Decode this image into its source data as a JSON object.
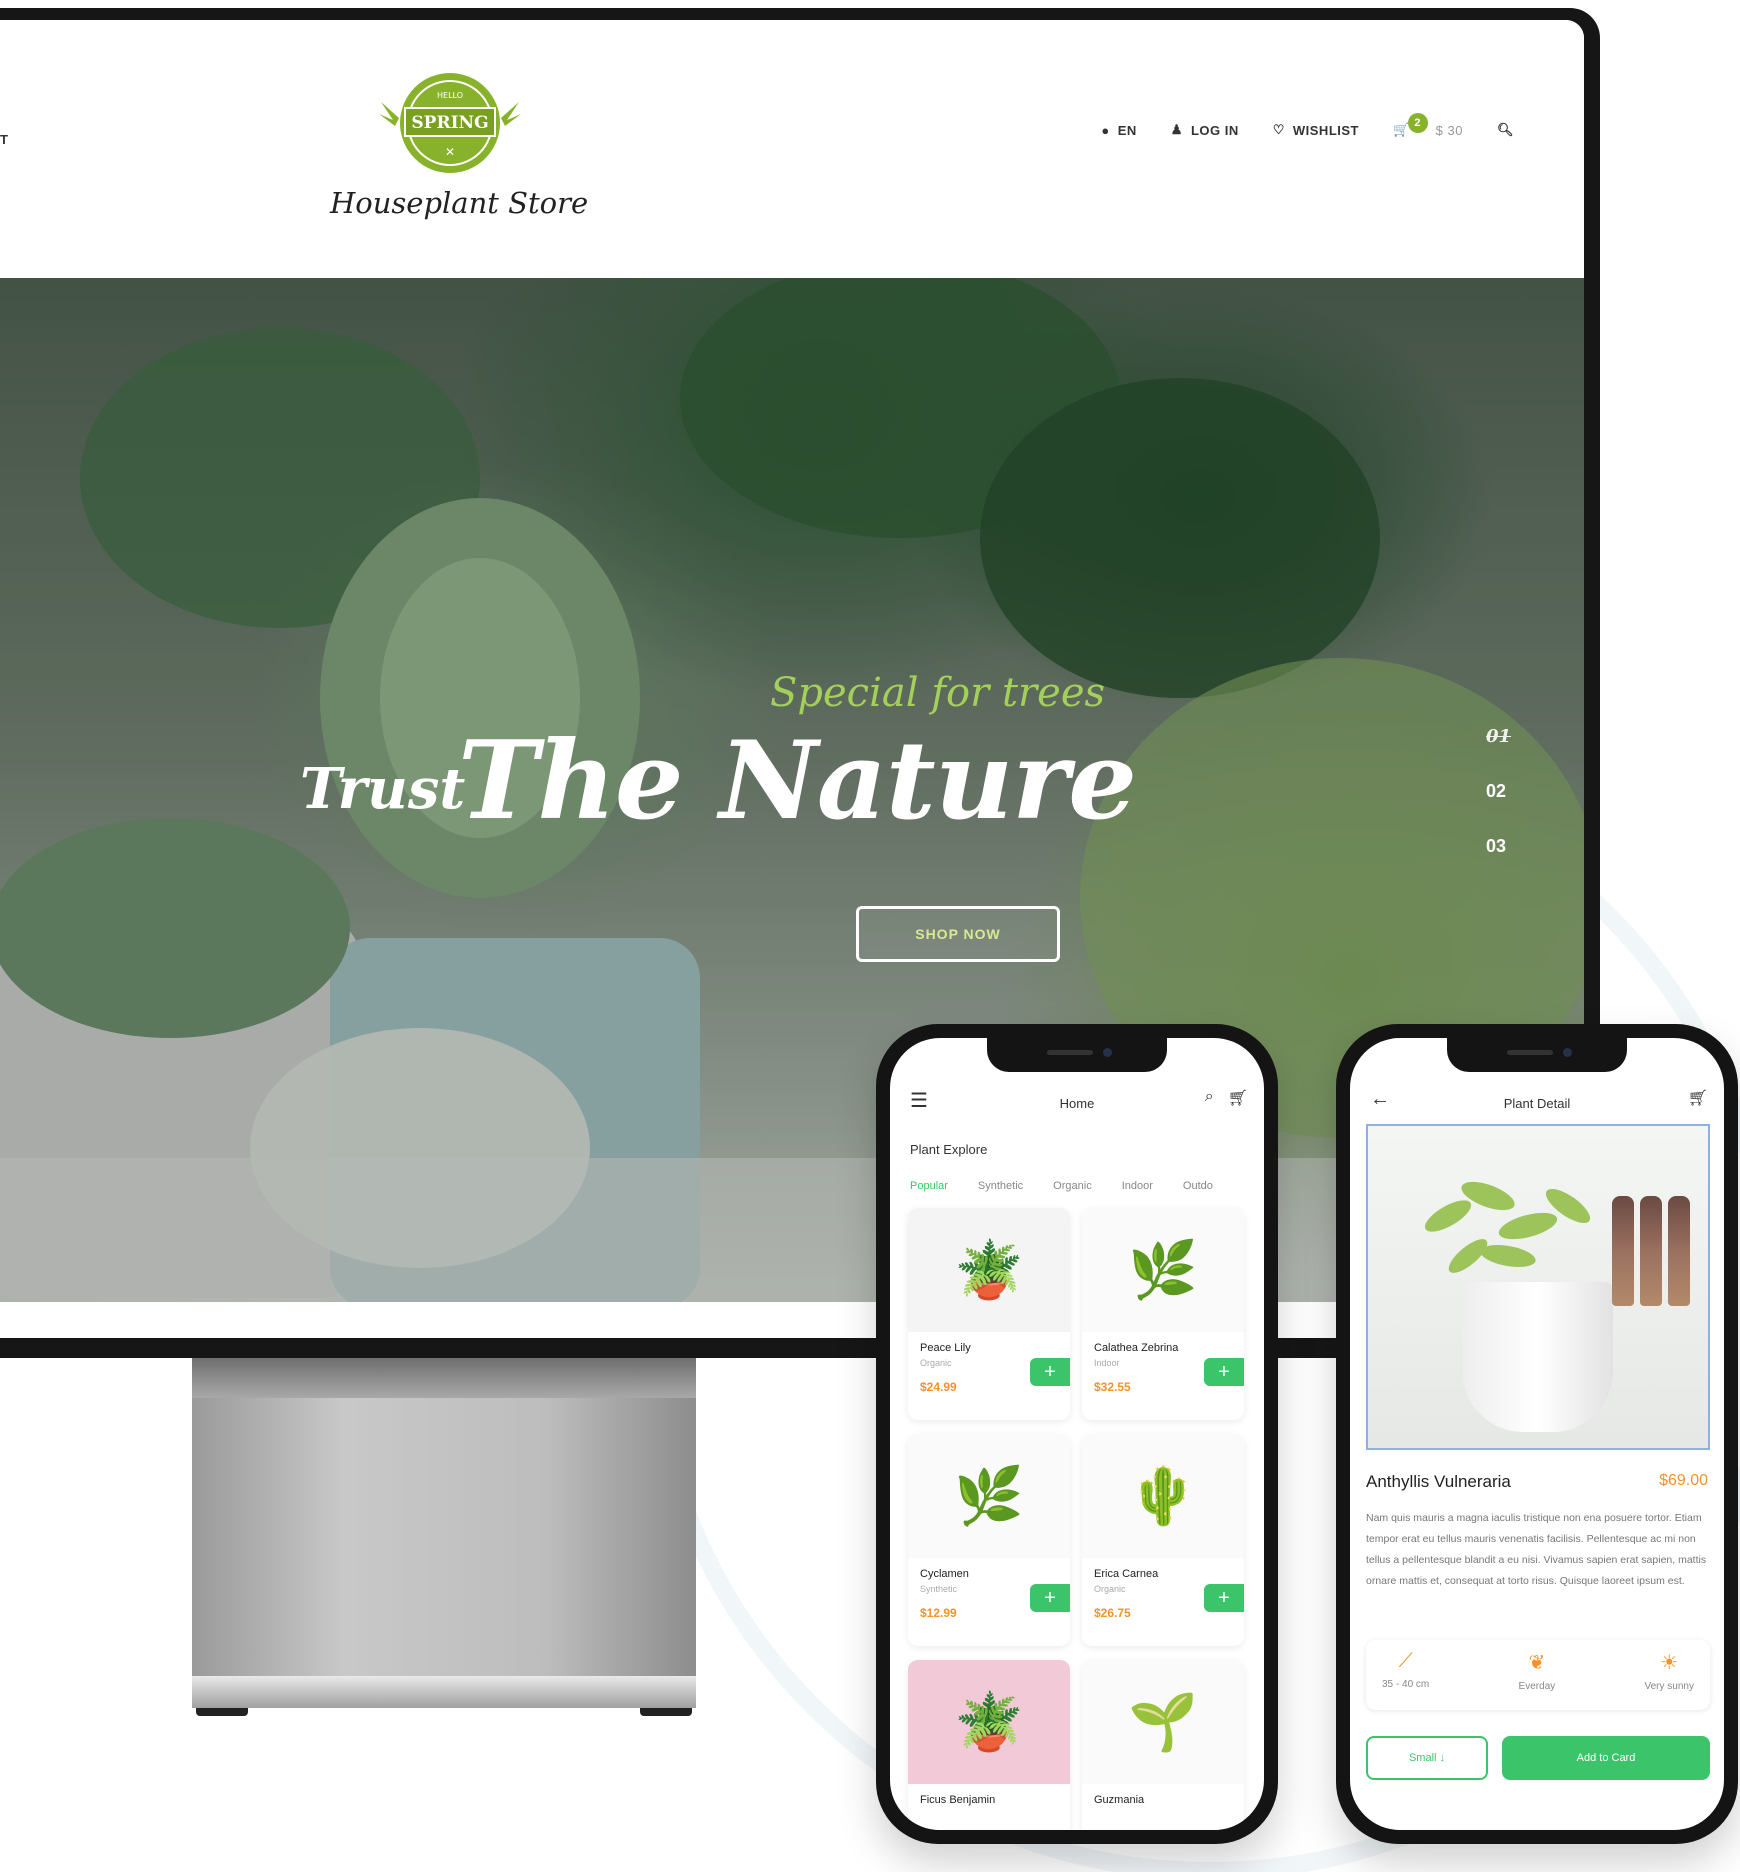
{
  "website": {
    "nav_left_fragment": "T",
    "logo": {
      "top_text": "HELLO",
      "main_text": "SPRING"
    },
    "store_name": "Houseplant Store",
    "nav": {
      "language": "EN",
      "login": "LOG IN",
      "wishlist": "WISHLIST",
      "cart_count": "2",
      "cart_total": "$ 30"
    },
    "hero": {
      "subtitle": "Special for trees",
      "title_small": "Trust",
      "title_large": "The Nature",
      "button": "SHOP NOW",
      "slides": [
        "01",
        "02",
        "03"
      ],
      "active_slide": "01"
    }
  },
  "phone_home": {
    "title": "Home",
    "section_title": "Plant Explore",
    "tabs": [
      "Popular",
      "Synthetic",
      "Organic",
      "Indoor",
      "Outdo"
    ],
    "active_tab": "Popular",
    "products": [
      {
        "name": "Peace Lily",
        "category": "Organic",
        "price": "$24.99",
        "icon": "🪴"
      },
      {
        "name": "Calathea Zebrina",
        "category": "Indoor",
        "price": "$32.55",
        "icon": "🌿"
      },
      {
        "name": "Cyclamen",
        "category": "Synthetic",
        "price": "$12.99",
        "icon": "🌿"
      },
      {
        "name": "Erica Carnea",
        "category": "Organic",
        "price": "$26.75",
        "icon": "🌵"
      },
      {
        "name": "Ficus Benjamin",
        "category": "",
        "price": "",
        "icon": "🪴"
      },
      {
        "name": "Guzmania",
        "category": "",
        "price": "",
        "icon": "🌱"
      }
    ],
    "add_label": "+"
  },
  "phone_detail": {
    "title": "Plant Detail",
    "product_name": "Anthyllis Vulneraria",
    "price": "$69.00",
    "description": "Nam quis mauris a magna iaculis tristique non ena posuere tortor. Etiam tempor erat eu tellus mauris venenatis facilisis. Pellentesque ac mi non tellus a pellentesque blandit a eu nisi. Vivamus sapien erat sapien, mattis ornare mattis et, consequat at torto risus. Quisque laoreet ipsum est.",
    "specs": [
      {
        "icon": "ruler-icon",
        "glyph": "⟋",
        "label": "35 - 40 cm"
      },
      {
        "icon": "water-icon",
        "glyph": "❦",
        "label": "Everday"
      },
      {
        "icon": "sun-icon",
        "glyph": "☀",
        "label": "Very sunny"
      }
    ],
    "size_button": "Small ↓",
    "add_button": "Add to Card"
  },
  "colors": {
    "accent_green": "#3cc46a",
    "logo_green": "#89b22c",
    "price_orange": "#f5922a",
    "hero_subtitle": "#a4cf5a"
  }
}
